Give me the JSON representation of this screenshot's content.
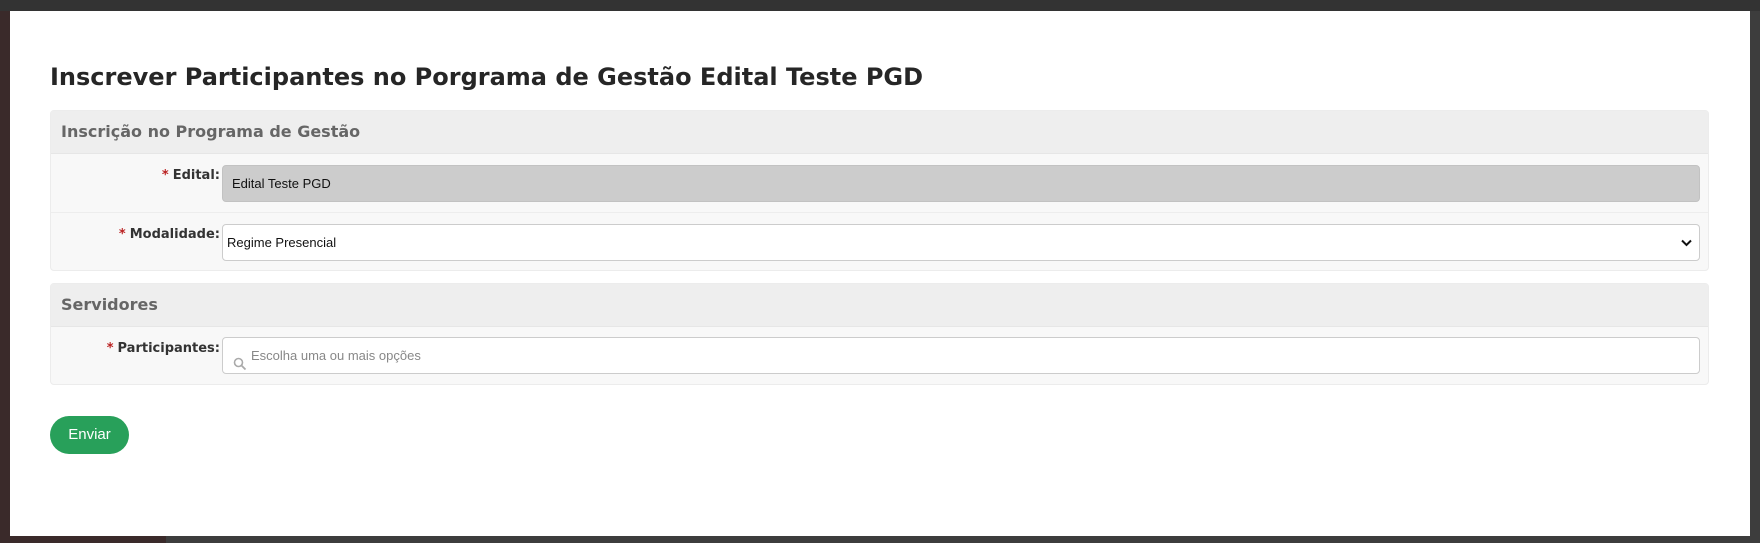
{
  "modal": {
    "title": "Inscrever Participantes no Porgrama de Gestão Edital Teste PGD"
  },
  "panels": [
    {
      "header": "Inscrição no Programa de Gestão",
      "fields": [
        {
          "label": "Edital:",
          "required_mark": "*",
          "value": "Edital Teste PGD"
        },
        {
          "label": "Modalidade:",
          "required_mark": "*",
          "value": "Regime Presencial"
        }
      ]
    },
    {
      "header": "Servidores",
      "fields": [
        {
          "label": "Participantes:",
          "required_mark": "*",
          "placeholder": "Escolha uma ou mais opções"
        }
      ]
    }
  ],
  "actions": {
    "submit_label": "Enviar"
  },
  "colors": {
    "submit_button": "#28a05a",
    "required_mark": "#ba2121",
    "panel_header_bg": "#eeeeee",
    "readonly_field_bg": "#cccccc"
  },
  "icons": {
    "search": "search-icon",
    "select_arrow": "chevron-down-icon"
  }
}
